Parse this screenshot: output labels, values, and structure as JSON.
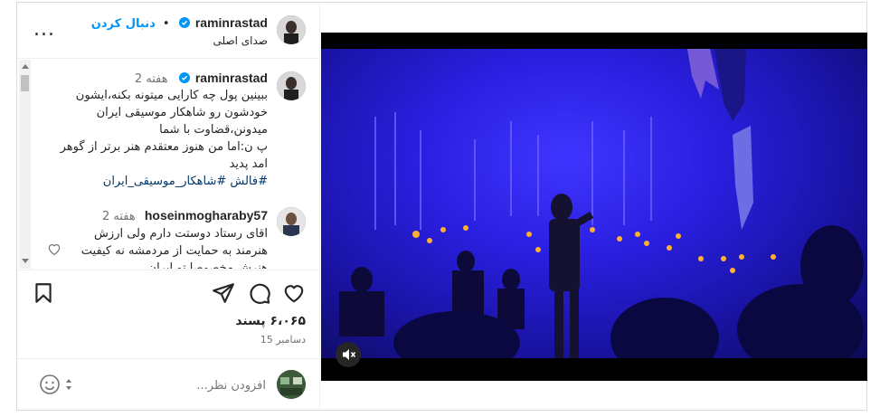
{
  "header": {
    "username": "raminrastad",
    "follow_label": "دنبال کردن",
    "audio": "صدای اصلی",
    "more": "..."
  },
  "comments": [
    {
      "username": "raminrastad",
      "time": "2 هفته",
      "text": "ببینین پول چه کارایی میتونه بکنه،ایشون خودشون رو شاهکار موسیقی ایران میدونن،قضاوت با شما\nپ ن:اما من هنوز معتقدم هنر برتر از گوهر امد پدید",
      "tags": "#فالش #شاهکار_موسیقی_ایران"
    },
    {
      "username": "hoseinmogharaby57",
      "time": "2 هفته",
      "text": "اقای رستاد دوستت دارم ولی ارزش هنرمند به حمایت از مردمشه نه کیفیت هنرش مخصوصا تو ایران"
    }
  ],
  "actions": {
    "likes": "۶،۰۶۵ پسند",
    "date": "دسامبر 15"
  },
  "add_comment": {
    "placeholder": "افزودن نظر..."
  },
  "icons": {
    "verified": "verified-badge-icon",
    "heart": "heart-icon",
    "comment": "comment-icon",
    "share": "share-icon",
    "save": "bookmark-icon",
    "emoji": "emoji-icon",
    "mute": "speaker-muted-icon"
  },
  "colors": {
    "link": "#0095f6",
    "hashtag": "#00376b",
    "stage": "#2a1fe0"
  }
}
